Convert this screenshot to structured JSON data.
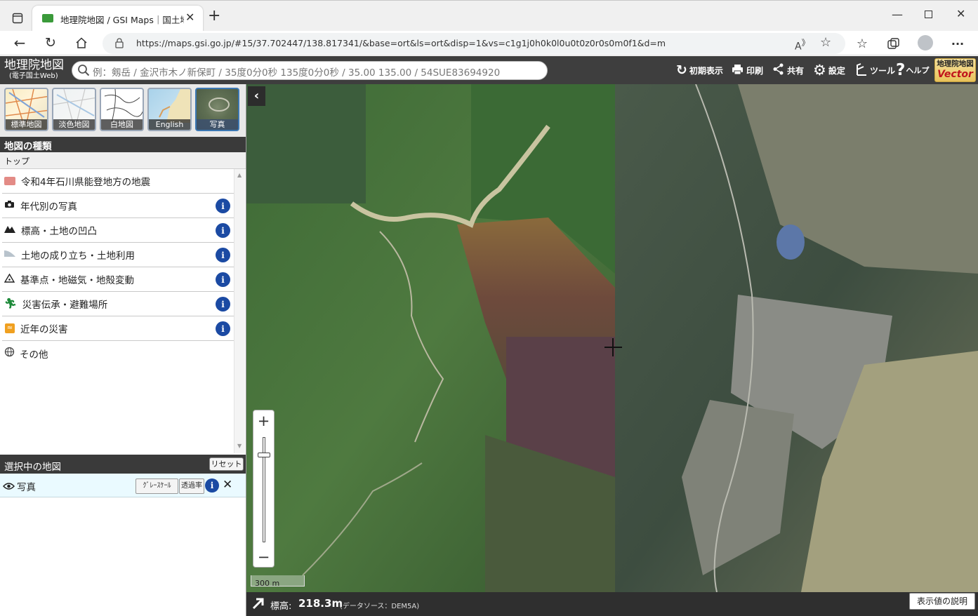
{
  "browser": {
    "tab_title": "地理院地図 / GSI Maps｜国土地理",
    "url": "https://maps.gsi.go.jp/#15/37.702447/138.817341/&base=ort&ls=ort&disp=1&vs=c1g1j0h0k0l0u0t0z0r0s0m0f1&d=m"
  },
  "header": {
    "logo_title": "地理院地図",
    "logo_sub": "(電子国土Web)",
    "search_placeholder": "例：剱岳 / 金沢市木ノ新保町 / 35度0分0秒 135度0分0秒 / 35.00 135.00 / 54SUE83694920",
    "btn_init": "初期表示",
    "btn_print": "印刷",
    "btn_share": "共有",
    "btn_settings": "設定",
    "btn_tools": "ツール",
    "btn_help": "ヘルプ",
    "vector_top": "地理院地図",
    "vector_bottom": "Vector"
  },
  "panel": {
    "thumbnails": [
      "標準地図",
      "淡色地図",
      "白地図",
      "English",
      "写真"
    ],
    "section_title": "地図の種類",
    "breadcrumb": "トップ",
    "items": [
      {
        "label": "令和4年石川県能登地方の地震",
        "icon": "folder-icon"
      },
      {
        "label": "年代別の写真",
        "icon": "camera-icon"
      },
      {
        "label": "標高・土地の凹凸",
        "icon": "mountain-icon"
      },
      {
        "label": "土地の成り立ち・土地利用",
        "icon": "landform-icon"
      },
      {
        "label": "基準点・地磁気・地殻変動",
        "icon": "triangle-icon"
      },
      {
        "label": "災害伝承・避難場所",
        "icon": "evacuation-icon"
      },
      {
        "label": "近年の災害",
        "icon": "disaster-icon"
      },
      {
        "label": "その他",
        "icon": "globe-icon"
      }
    ],
    "selected_title": "選択中の地図",
    "reset": "リセット",
    "selected_layer": "写真",
    "grayscale": "ｸﾞﾚｰｽｹｰﾙ",
    "opacity": "透過率"
  },
  "map": {
    "scale": "300 m",
    "zoom_in": "+",
    "zoom_out": "−"
  },
  "footer": {
    "elev_label": "標高:",
    "elev_value": "218.3m",
    "source": "(データソース：DEM5A)",
    "explain": "表示値の説明"
  }
}
